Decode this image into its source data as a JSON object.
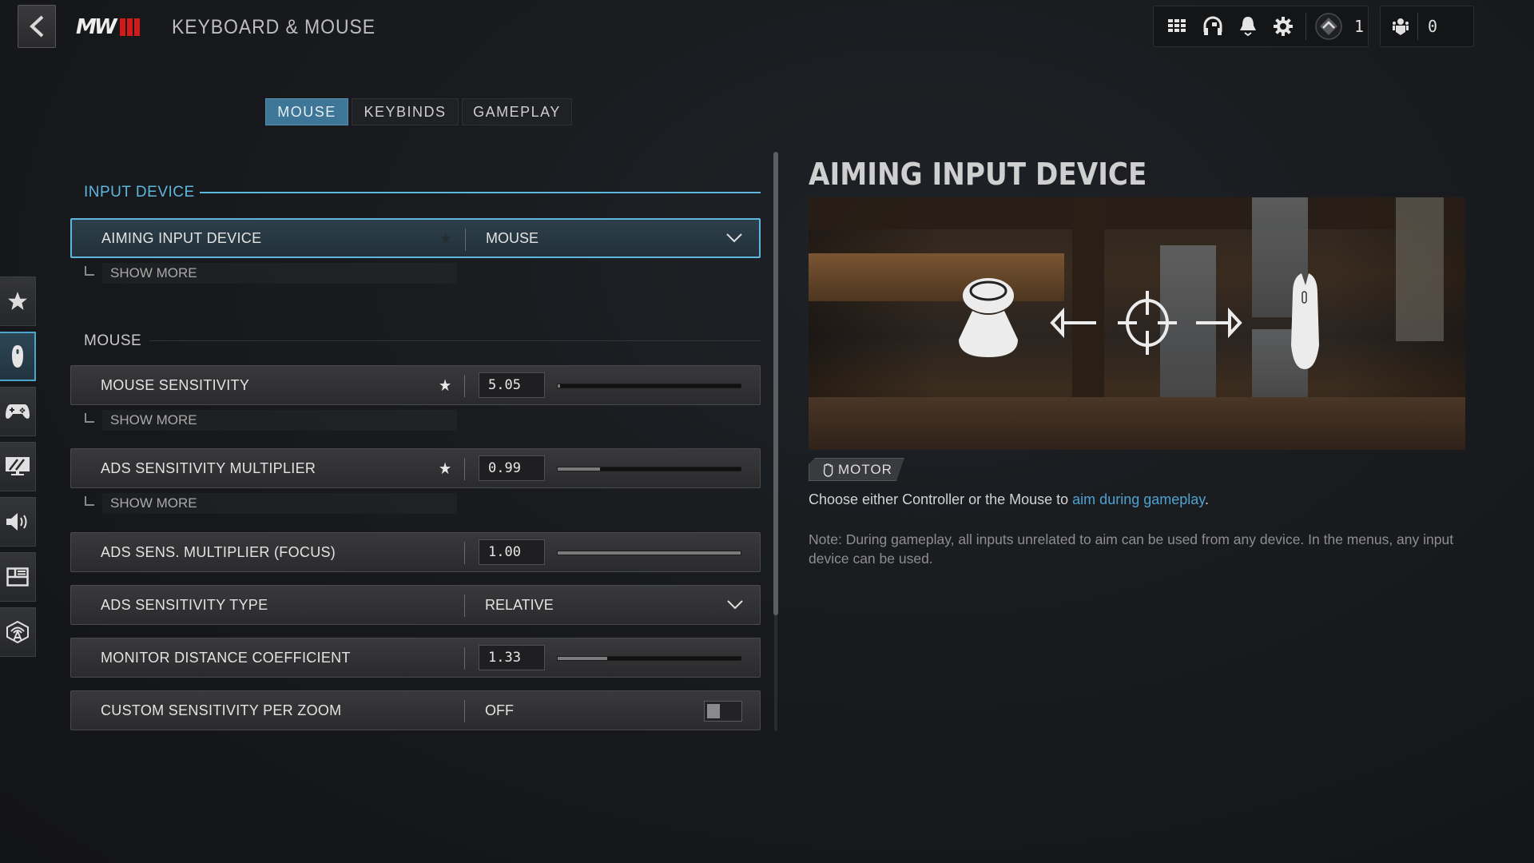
{
  "header": {
    "back_icon": "chevron-left-icon",
    "logo_text": "MW",
    "title": "KEYBOARD & MOUSE"
  },
  "topbar": {
    "icons": [
      "grid-menu-icon",
      "headset-icon",
      "bell-icon",
      "gear-icon",
      "rank-badge-icon"
    ],
    "rank_level": "1",
    "party_icon": "party-icon",
    "party_count": "0"
  },
  "tabs": [
    {
      "label": "MOUSE",
      "active": true
    },
    {
      "label": "KEYBINDS",
      "active": false
    },
    {
      "label": "GAMEPLAY",
      "active": false
    }
  ],
  "sidebar": {
    "items": [
      {
        "icon": "star-icon",
        "name": "favorites"
      },
      {
        "icon": "mouse-icon",
        "name": "keyboard-mouse",
        "active": true
      },
      {
        "icon": "gamepad-icon",
        "name": "controller"
      },
      {
        "icon": "monitor-icon",
        "name": "graphics"
      },
      {
        "icon": "speaker-icon",
        "name": "audio"
      },
      {
        "icon": "interface-icon",
        "name": "interface"
      },
      {
        "icon": "network-icon",
        "name": "account-network"
      }
    ]
  },
  "sections": {
    "input_device": "INPUT DEVICE",
    "mouse": "MOUSE"
  },
  "settings": {
    "show_more": "SHOW MORE",
    "aiming_input_device": {
      "label": "AIMING INPUT DEVICE",
      "value": "MOUSE",
      "favorite": false
    },
    "mouse_sensitivity": {
      "label": "MOUSE SENSITIVITY",
      "value": "5.05",
      "slider_fraction": 0.015,
      "favorite": true
    },
    "ads_sensitivity_multiplier": {
      "label": "ADS SENSITIVITY MULTIPLIER",
      "value": "0.99",
      "slider_fraction": 0.23,
      "favorite": true
    },
    "ads_sens_multiplier_focus": {
      "label": "ADS SENS. MULTIPLIER (FOCUS)",
      "value": "1.00",
      "slider_fraction": 1.0
    },
    "ads_sensitivity_type": {
      "label": "ADS SENSITIVITY TYPE",
      "value": "RELATIVE"
    },
    "monitor_distance_coefficient": {
      "label": "MONITOR DISTANCE COEFFICIENT",
      "value": "1.33",
      "slider_fraction": 0.27
    },
    "custom_sensitivity_per_zoom": {
      "label": "CUSTOM SENSITIVITY PER ZOOM",
      "value": "OFF"
    }
  },
  "detail": {
    "title": "AIMING INPUT DEVICE",
    "tag": "MOTOR",
    "desc_prefix": "Choose either Controller or the Mouse to ",
    "desc_link": "aim during gameplay",
    "desc_suffix": ".",
    "note": "Note: During gameplay, all inputs unrelated to aim can be used from any device. In the menus, any input device can be used."
  },
  "colors": {
    "accent": "#5db7de",
    "tab_active": "#3e7697",
    "link": "#4da3d4",
    "logo_red": "#d11a1a"
  }
}
